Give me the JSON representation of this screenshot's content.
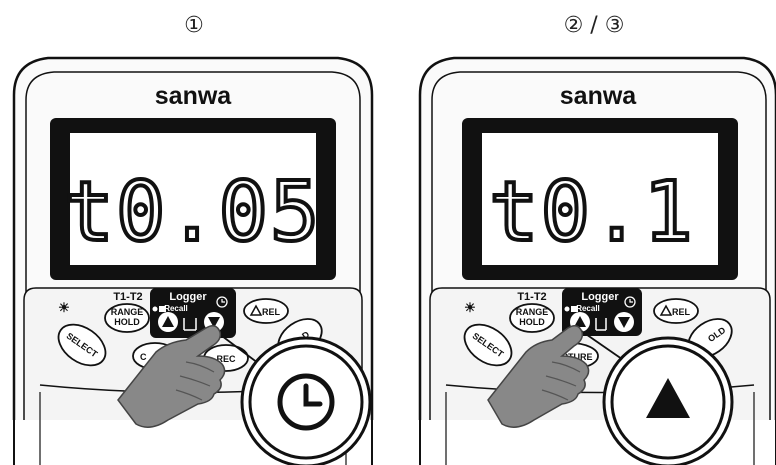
{
  "panels": [
    {
      "step_label": "①",
      "brand": "sanwa",
      "display": "t0.05",
      "t1t2": "T1-T2",
      "logger": "Logger",
      "recall": "Recall",
      "range_hold": [
        "RANGE",
        "HOLD"
      ],
      "rel": "REL",
      "select": "SELECT",
      "rec": "REC",
      "capture_partial": "C",
      "hold_partial": "D",
      "pressed_button": "clock-button",
      "zoom_icon": "clock-icon"
    },
    {
      "step_label": "② / ③",
      "brand": "sanwa",
      "display": "t0.1",
      "t1t2": "T1-T2",
      "logger": "Logger",
      "recall": "Recall",
      "range_hold": [
        "RANGE",
        "HOLD"
      ],
      "rel": "REL",
      "select": "SELECT",
      "capture_partial": "APTURE",
      "hold_partial": "OLD",
      "pressed_button": "up-button",
      "zoom_icon": "up-triangle-icon"
    }
  ]
}
